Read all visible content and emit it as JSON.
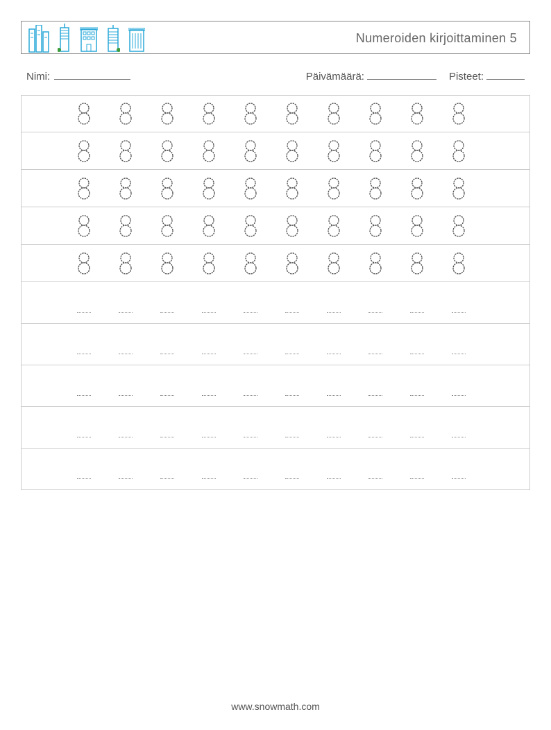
{
  "header": {
    "title": "Numeroiden kirjoittaminen 5"
  },
  "meta": {
    "name_label": "Nimi:",
    "date_label": "Päivämäärä:",
    "score_label": "Pisteet:"
  },
  "worksheet": {
    "trace_digit": "8",
    "trace_rows": 5,
    "practice_rows": 5,
    "cols": 10
  },
  "footer": {
    "url": "www.snowmath.com"
  }
}
